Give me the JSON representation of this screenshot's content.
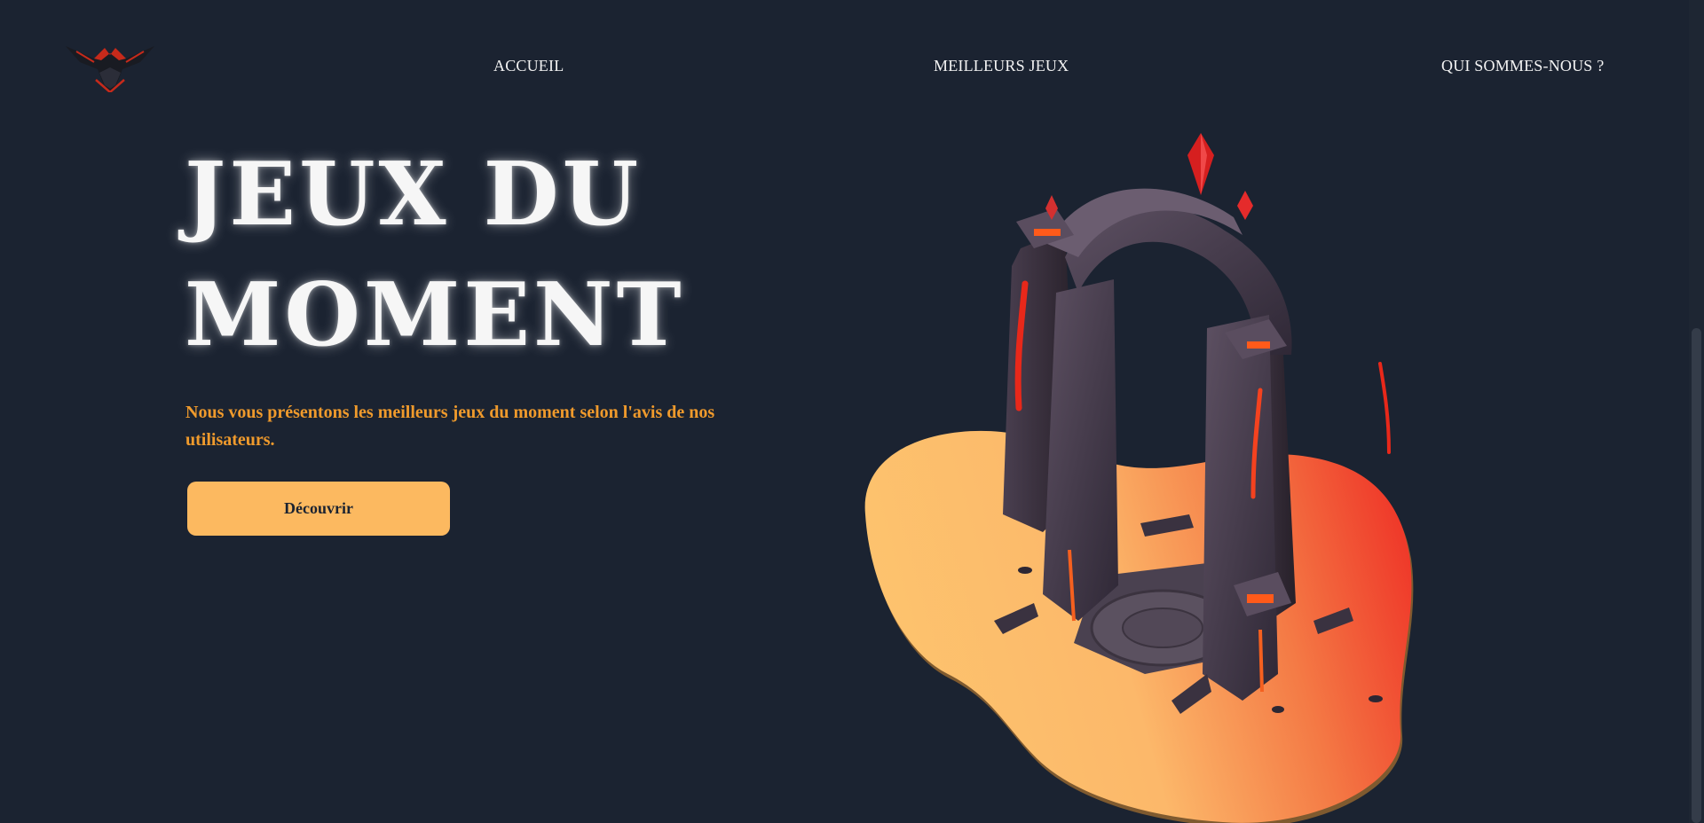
{
  "nav": {
    "logo_icon": "phoenix-logo-icon",
    "items": [
      {
        "label": "ACCUEIL"
      },
      {
        "label": "MEILLEURS JEUX"
      },
      {
        "label": "QUI SOMMES-NOUS ?"
      }
    ]
  },
  "hero": {
    "title": "JEUX DU MOMENT",
    "description": "Nous vous présentons les meilleurs jeux du moment selon l'avis de nos utilisateurs.",
    "button_label": "Découvrir",
    "illustration_icon": "dark-portal-illustration"
  },
  "colors": {
    "background": "#1b2331",
    "accent": "#ef9a2c",
    "button": "#fcb960",
    "blob_start": "#fdc46e",
    "blob_end": "#ef3a2a",
    "text": "#f6f6f6"
  }
}
